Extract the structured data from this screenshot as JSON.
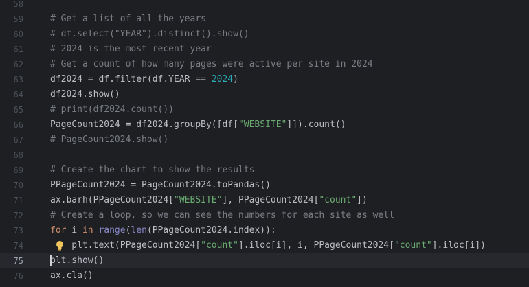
{
  "colors": {
    "background": "#1e1f22",
    "current_line": "#26282e",
    "comment": "#7a7e85",
    "keyword": "#cf8e6d",
    "string": "#6aab73",
    "number": "#2aacb8",
    "builtin": "#8888c6",
    "plain": "#bcbec4"
  },
  "editor": {
    "current_line": "75",
    "intention_icon": "lightbulb-icon",
    "lines": [
      {
        "num": "58",
        "tokens": []
      },
      {
        "num": "59",
        "tokens": [
          {
            "t": "comment",
            "v": "# Get a list of all the years"
          }
        ]
      },
      {
        "num": "60",
        "tokens": [
          {
            "t": "comment",
            "v": "# df.select(\"YEAR\").distinct().show()"
          }
        ]
      },
      {
        "num": "61",
        "tokens": [
          {
            "t": "comment",
            "v": "# 2024 is the most recent year"
          }
        ]
      },
      {
        "num": "62",
        "tokens": [
          {
            "t": "comment",
            "v": "# Get a count of how many pages were active per site in 2024"
          }
        ]
      },
      {
        "num": "63",
        "tokens": [
          {
            "t": "plain",
            "v": "df2024 = df.filter(df.YEAR == "
          },
          {
            "t": "number",
            "v": "2024"
          },
          {
            "t": "plain",
            "v": ")"
          }
        ]
      },
      {
        "num": "64",
        "tokens": [
          {
            "t": "plain",
            "v": "df2024.show()"
          }
        ]
      },
      {
        "num": "65",
        "tokens": [
          {
            "t": "comment",
            "v": "# print(df2024.count())"
          }
        ]
      },
      {
        "num": "66",
        "tokens": [
          {
            "t": "plain",
            "v": "PageCount2024 = df2024.groupBy([df["
          },
          {
            "t": "string",
            "v": "\"WEBSITE\""
          },
          {
            "t": "plain",
            "v": "]]).count()"
          }
        ]
      },
      {
        "num": "67",
        "tokens": [
          {
            "t": "comment",
            "v": "# PageCount2024.show()"
          }
        ]
      },
      {
        "num": "68",
        "tokens": []
      },
      {
        "num": "69",
        "tokens": [
          {
            "t": "comment",
            "v": "# Create the chart to show the results"
          }
        ]
      },
      {
        "num": "70",
        "tokens": [
          {
            "t": "plain",
            "v": "PPageCount2024 = PageCount2024.toPandas()"
          }
        ]
      },
      {
        "num": "71",
        "tokens": [
          {
            "t": "plain",
            "v": "ax.barh(PPageCount2024["
          },
          {
            "t": "string",
            "v": "\"WEBSITE\""
          },
          {
            "t": "plain",
            "v": "], PPageCount2024["
          },
          {
            "t": "string",
            "v": "\"count\""
          },
          {
            "t": "plain",
            "v": "])"
          }
        ]
      },
      {
        "num": "72",
        "tokens": [
          {
            "t": "comment",
            "v": "# Create a loop, so we can see the numbers for each site as well"
          }
        ]
      },
      {
        "num": "73",
        "tokens": [
          {
            "t": "keyword",
            "v": "for"
          },
          {
            "t": "plain",
            "v": " i "
          },
          {
            "t": "keyword",
            "v": "in"
          },
          {
            "t": "plain",
            "v": " "
          },
          {
            "t": "builtin",
            "v": "range"
          },
          {
            "t": "plain",
            "v": "("
          },
          {
            "t": "builtin",
            "v": "len"
          },
          {
            "t": "plain",
            "v": "(PPageCount2024.index)):"
          }
        ]
      },
      {
        "num": "74",
        "tokens": [
          {
            "t": "plain",
            "v": "    plt.text(PPageCount2024["
          },
          {
            "t": "string",
            "v": "\"count\""
          },
          {
            "t": "plain",
            "v": "].iloc[i], i, PPageCount2024["
          },
          {
            "t": "string",
            "v": "\"count\""
          },
          {
            "t": "plain",
            "v": "].iloc[i])"
          }
        ],
        "bulb": true
      },
      {
        "num": "75",
        "tokens": [
          {
            "t": "plain",
            "v": "plt.show()"
          }
        ],
        "caret": true
      },
      {
        "num": "76",
        "tokens": [
          {
            "t": "plain",
            "v": "ax.cla()"
          }
        ]
      }
    ]
  }
}
